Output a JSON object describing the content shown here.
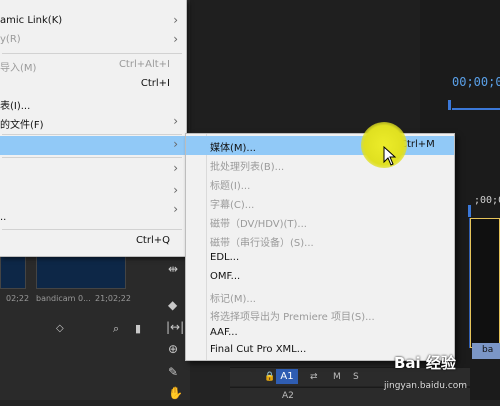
{
  "main_menu": {
    "items": [
      {
        "label": "amic Link(K)",
        "shortcut": "",
        "arrow": "›",
        "disabled": false,
        "highlighted": false
      },
      {
        "label": "y(R)",
        "shortcut": "",
        "arrow": "›",
        "disabled": true,
        "highlighted": false
      },
      {
        "label": "导入(M)",
        "shortcut": "Ctrl+Alt+I",
        "arrow": "",
        "disabled": true,
        "highlighted": false
      },
      {
        "label": "",
        "shortcut": "Ctrl+I",
        "arrow": "",
        "disabled": false,
        "highlighted": false
      },
      {
        "label": "表(I)...",
        "shortcut": "",
        "arrow": "",
        "disabled": false,
        "highlighted": false
      },
      {
        "label": "的文件(F)",
        "shortcut": "",
        "arrow": "›",
        "disabled": false,
        "highlighted": false
      },
      {
        "label": "",
        "shortcut": "",
        "arrow": "›",
        "disabled": false,
        "highlighted": true
      },
      {
        "label": "",
        "shortcut": "",
        "arrow": "›",
        "disabled": false,
        "highlighted": false
      },
      {
        "label": "",
        "shortcut": "",
        "arrow": "›",
        "disabled": true,
        "highlighted": false
      },
      {
        "label": "",
        "shortcut": "",
        "arrow": "›",
        "disabled": true,
        "highlighted": false
      },
      {
        "label": "..",
        "shortcut": "",
        "arrow": "",
        "disabled": false,
        "highlighted": false
      },
      {
        "label": "",
        "shortcut": "Ctrl+Q",
        "arrow": "",
        "disabled": false,
        "highlighted": false
      }
    ]
  },
  "sub_menu": {
    "items": [
      {
        "label": "媒体(M)...",
        "shortcut": "Ctrl+M",
        "disabled": false,
        "highlighted": true
      },
      {
        "label": "批处理列表(B)...",
        "shortcut": "",
        "disabled": true,
        "highlighted": false
      },
      {
        "label": "标题(I)...",
        "shortcut": "",
        "disabled": true,
        "highlighted": false
      },
      {
        "label": "字幕(C)...",
        "shortcut": "",
        "disabled": true,
        "highlighted": false
      },
      {
        "label": "磁带（DV/HDV)(T)...",
        "shortcut": "",
        "disabled": true,
        "highlighted": false
      },
      {
        "label": "磁带（串行设备）(S)...",
        "shortcut": "",
        "disabled": true,
        "highlighted": false
      },
      {
        "label": "EDL...",
        "shortcut": "",
        "disabled": false,
        "highlighted": false
      },
      {
        "label": "OMF...",
        "shortcut": "",
        "disabled": false,
        "highlighted": false
      },
      {
        "label": "标记(M)...",
        "shortcut": "",
        "disabled": true,
        "highlighted": false
      },
      {
        "label": "将选择项导出为 Premiere 项目(S)...",
        "shortcut": "",
        "disabled": true,
        "highlighted": false
      },
      {
        "label": "AAF...",
        "shortcut": "",
        "disabled": false,
        "highlighted": false
      },
      {
        "label": "Final Cut Pro XML...",
        "shortcut": "",
        "disabled": false,
        "highlighted": false
      }
    ]
  },
  "background": {
    "timecode_top": "00;00;0",
    "timecode_mid": ";00;00",
    "thumb_caption_1": "02;22",
    "thumb_caption_2": "bandicam 0...",
    "thumb_caption_3": "21;02;22",
    "track_a1": "A1",
    "track_a2": "A2",
    "track_m": "M",
    "track_s": "S",
    "clip_label": "ba"
  },
  "watermark": {
    "brand": "Bai 经验",
    "url": "jingyan.baidu.com"
  },
  "colors": {
    "highlight": "#91c9f7",
    "menu_bg": "#f1f1f1",
    "timecode": "#5aa0e8"
  }
}
